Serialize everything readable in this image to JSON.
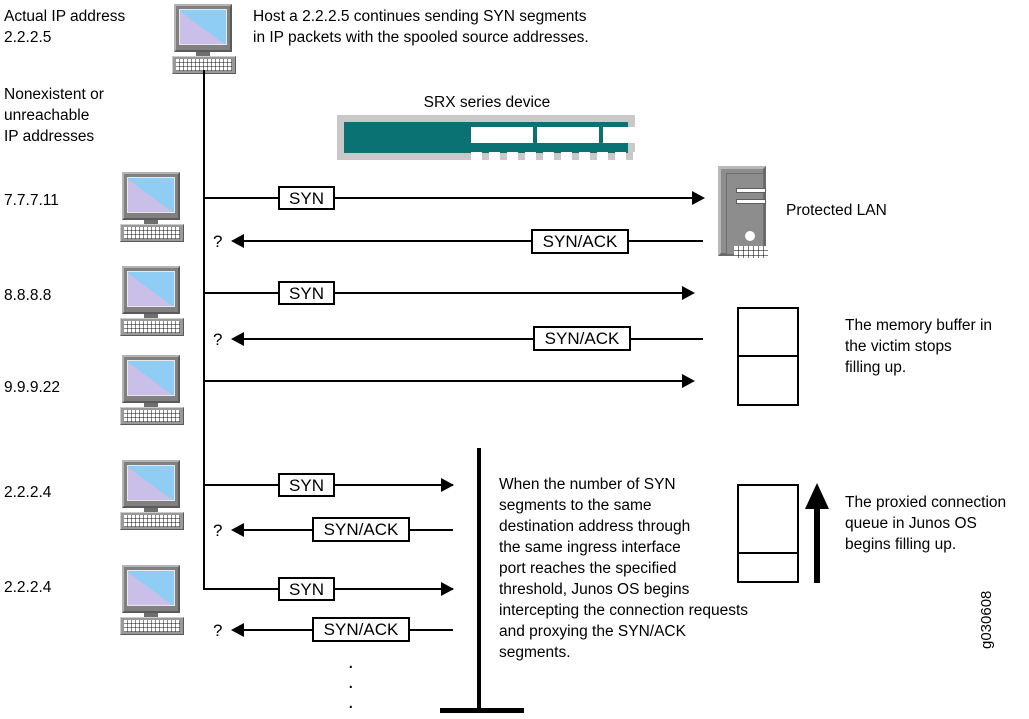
{
  "diagram": {
    "title_srx": "SRX series device",
    "watermark": "g030608",
    "dots": "."
  },
  "annotations": {
    "actual_ip": "Actual IP address\n2.2.2.5",
    "nonexistent": "Nonexistent or\nunreachable\nIP addresses",
    "host_note": "Host a 2.2.2.5 continues sending SYN segments\nin IP packets with the spooled source addresses.",
    "protected_lan": "Protected LAN",
    "memory_buffer": "The memory buffer in\nthe victim stops\nfilling up.",
    "proxied_queue": "The proxied connection\nqueue in Junos OS\nbegins filling up.",
    "threshold_note": "When the number of SYN\nsegments to the same\ndestination address through\nthe same ingress interface\nport reaches the specified\nthreshold, Junos OS begins\nintercepting the connection requests\nand proxying the SYN/ACK\nsegments."
  },
  "hosts": [
    {
      "ip": "7.7.7.11"
    },
    {
      "ip": "8.8.8.8"
    },
    {
      "ip": "9.9.9.22"
    },
    {
      "ip": "2.2.2.4"
    },
    {
      "ip": "2.2.2.4"
    }
  ],
  "packets": {
    "syn": "SYN",
    "syn_ack": "SYN/ACK",
    "question": "?"
  },
  "flows": [
    {
      "host_ip": "7.7.7.11",
      "request": "SYN",
      "reply": "SYN/ACK",
      "reply_marker": "?"
    },
    {
      "host_ip": "8.8.8.8",
      "request": "SYN",
      "reply": "SYN/ACK",
      "reply_marker": "?"
    },
    {
      "host_ip": "9.9.9.22",
      "request": "",
      "reply": "",
      "reply_marker": ""
    },
    {
      "host_ip": "2.2.2.4",
      "request": "SYN",
      "reply": "SYN/ACK",
      "reply_marker": "?"
    },
    {
      "host_ip": "2.2.2.4",
      "request": "SYN",
      "reply": "SYN/ACK",
      "reply_marker": "?"
    }
  ],
  "colors": {
    "srx_body": "#0a7272",
    "srx_shell": "#c9c9c9",
    "screen": "#8fcdf5",
    "screen_highlight": "#c9bfe8",
    "line": "#000000"
  }
}
